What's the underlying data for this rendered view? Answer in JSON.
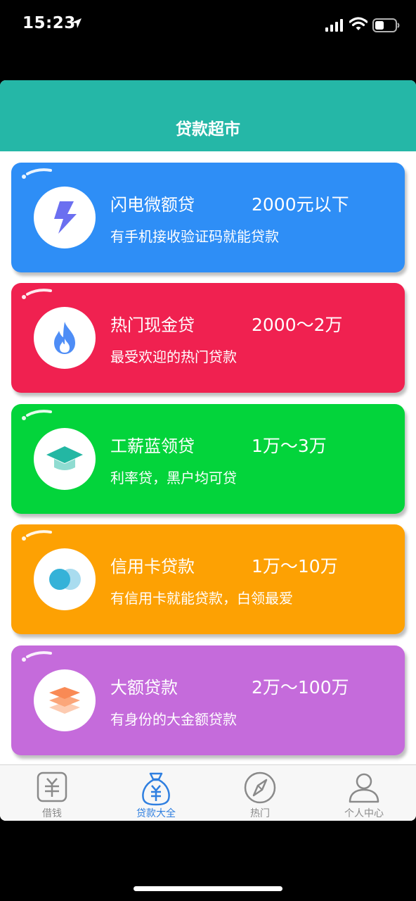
{
  "status": {
    "time": "15:23"
  },
  "header": {
    "title": "贷款超市"
  },
  "cards": [
    {
      "name": "闪电微额贷",
      "amount": "2000元以下",
      "desc": "有手机接收验证码就能贷款",
      "color": "#2e8ef6",
      "icon": "lightning-icon"
    },
    {
      "name": "热门现金贷",
      "amount": "2000～2万",
      "desc": "最受欢迎的热门贷款",
      "color": "#f02150",
      "icon": "flame-icon"
    },
    {
      "name": "工薪蓝领贷",
      "amount": "1万～3万",
      "desc": "利率贷，黑户均可贷",
      "color": "#03d43b",
      "icon": "graduation-cap-icon"
    },
    {
      "name": "信用卡贷款",
      "amount": "1万～10万",
      "desc": "有信用卡就能贷款，白领最爱",
      "color": "#fda103",
      "icon": "credit-card-circles-icon"
    },
    {
      "name": "大额贷款",
      "amount": "2万～100万",
      "desc": "有身份的大金额贷款",
      "color": "#c56bdb",
      "icon": "layers-icon"
    }
  ],
  "tabs": [
    {
      "label": "借钱",
      "icon": "yen-box-icon",
      "active": false
    },
    {
      "label": "贷款大全",
      "icon": "money-bag-icon",
      "active": true
    },
    {
      "label": "热门",
      "icon": "compass-icon",
      "active": false
    },
    {
      "label": "个人中心",
      "icon": "person-icon",
      "active": false
    }
  ]
}
